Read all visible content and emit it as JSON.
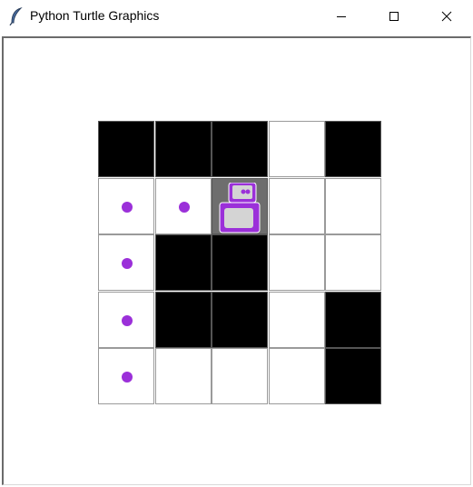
{
  "window": {
    "title": "Python Turtle Graphics",
    "app_icon": "feather-icon",
    "controls": [
      "minimize-icon",
      "maximize-icon",
      "close-icon"
    ]
  },
  "board": {
    "rows": 5,
    "cols": 5,
    "cells": [
      [
        "wall",
        "wall",
        "wall",
        "empty",
        "wall"
      ],
      [
        "dot",
        "dot",
        "robot",
        "empty",
        "empty"
      ],
      [
        "dot",
        "wall",
        "wall",
        "empty",
        "empty"
      ],
      [
        "dot",
        "wall",
        "wall",
        "empty",
        "wall"
      ],
      [
        "dot",
        "empty",
        "empty",
        "empty",
        "wall"
      ]
    ],
    "robot_icon": "robot-icon",
    "colors": {
      "wall": "#000000",
      "empty": "#ffffff",
      "robot_cell": "#6e6e6e",
      "dot": "#9b30d9",
      "robot_body": "#9b30d9",
      "robot_screen": "#d4d4d4"
    }
  }
}
